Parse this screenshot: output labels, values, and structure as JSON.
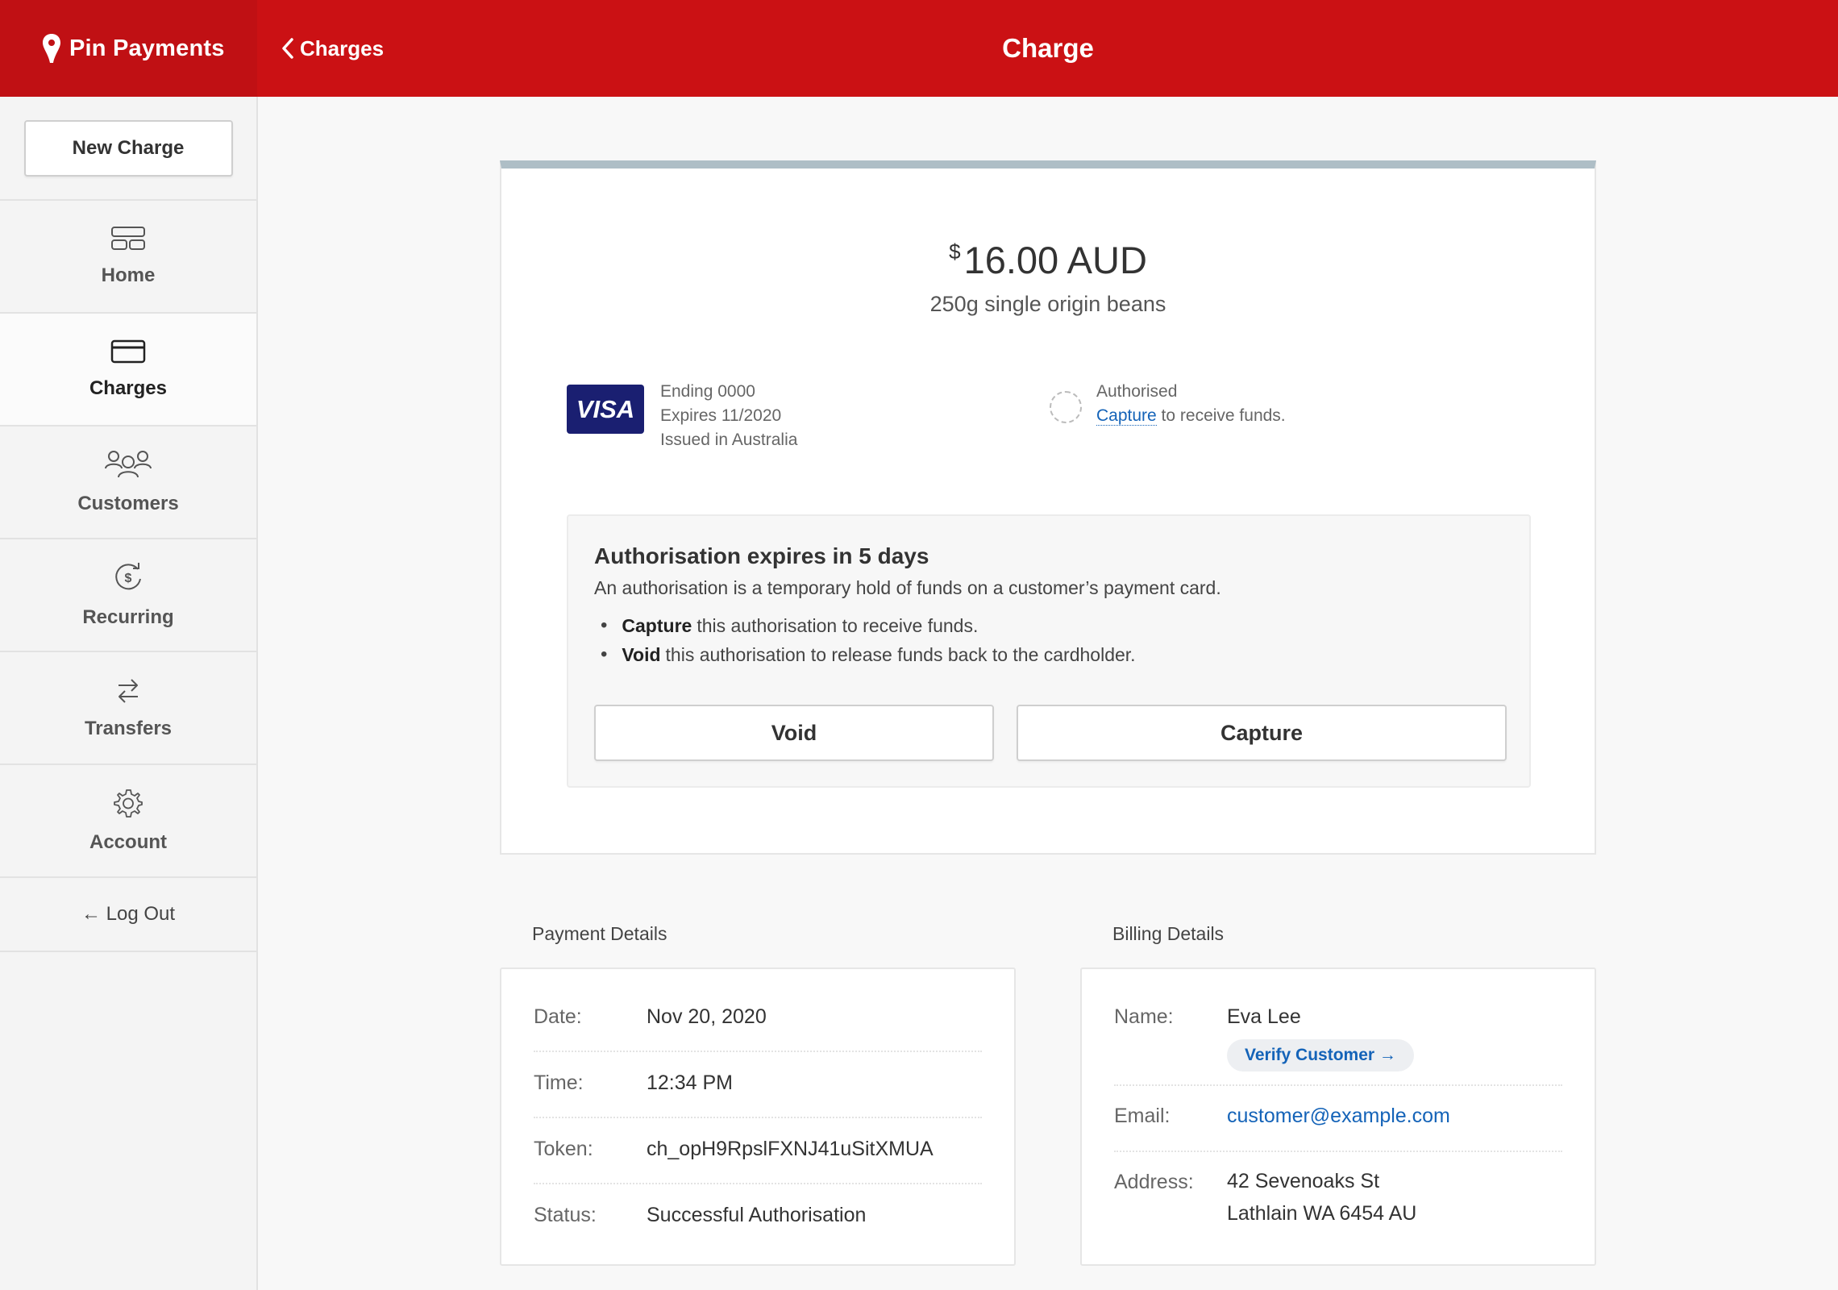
{
  "brand": {
    "name": "Pin Payments"
  },
  "header": {
    "back_label": "Charges",
    "title": "Charge"
  },
  "sidebar": {
    "new_charge_label": "New Charge",
    "items": [
      {
        "label": "Home",
        "icon": "home-icon"
      },
      {
        "label": "Charges",
        "icon": "card-icon",
        "active": true
      },
      {
        "label": "Customers",
        "icon": "customers-icon"
      },
      {
        "label": "Recurring",
        "icon": "recurring-icon"
      },
      {
        "label": "Transfers",
        "icon": "transfers-icon"
      },
      {
        "label": "Account",
        "icon": "gear-icon"
      }
    ],
    "logout_label": "← Log Out"
  },
  "charge": {
    "currency_symbol": "$",
    "amount": "16.00 AUD",
    "description": "250g single origin beans",
    "card_brand": "VISA",
    "card_ending": "Ending 0000",
    "card_expires": "Expires 11/2020",
    "card_issued": "Issued in Australia",
    "status_label": "Authorised",
    "status_link": "Capture",
    "status_suffix": " to receive funds."
  },
  "auth_notice": {
    "title": "Authorisation expires in 5 days",
    "subtitle": "An authorisation is a temporary hold of funds on a customer’s payment card.",
    "bullets": [
      {
        "bold": "Capture",
        "text": "this authorisation to receive funds."
      },
      {
        "bold": "Void",
        "text": "this authorisation to release funds back to the cardholder."
      }
    ],
    "void_label": "Void",
    "capture_label": "Capture"
  },
  "payment_details": {
    "title": "Payment Details",
    "rows": [
      {
        "label": "Date:",
        "value": "Nov 20, 2020"
      },
      {
        "label": "Time:",
        "value": "12:34 PM"
      },
      {
        "label": "Token:",
        "value": "ch_opH9RpslFXNJ41uSitXMUA"
      },
      {
        "label": "Status:",
        "value": "Successful Authorisation"
      }
    ]
  },
  "billing_details": {
    "title": "Billing Details",
    "name_label": "Name:",
    "name_value": "Eva Lee",
    "verify_label": "Verify Customer →",
    "email_label": "Email:",
    "email_value": "customer@example.com",
    "address_label": "Address:",
    "address_line1": "42 Sevenoaks St",
    "address_line2": "Lathlain WA 6454 AU"
  },
  "colors": {
    "brand_red": "#cb1114",
    "link_blue": "#1463b8",
    "visa_blue": "#1a1f71"
  }
}
